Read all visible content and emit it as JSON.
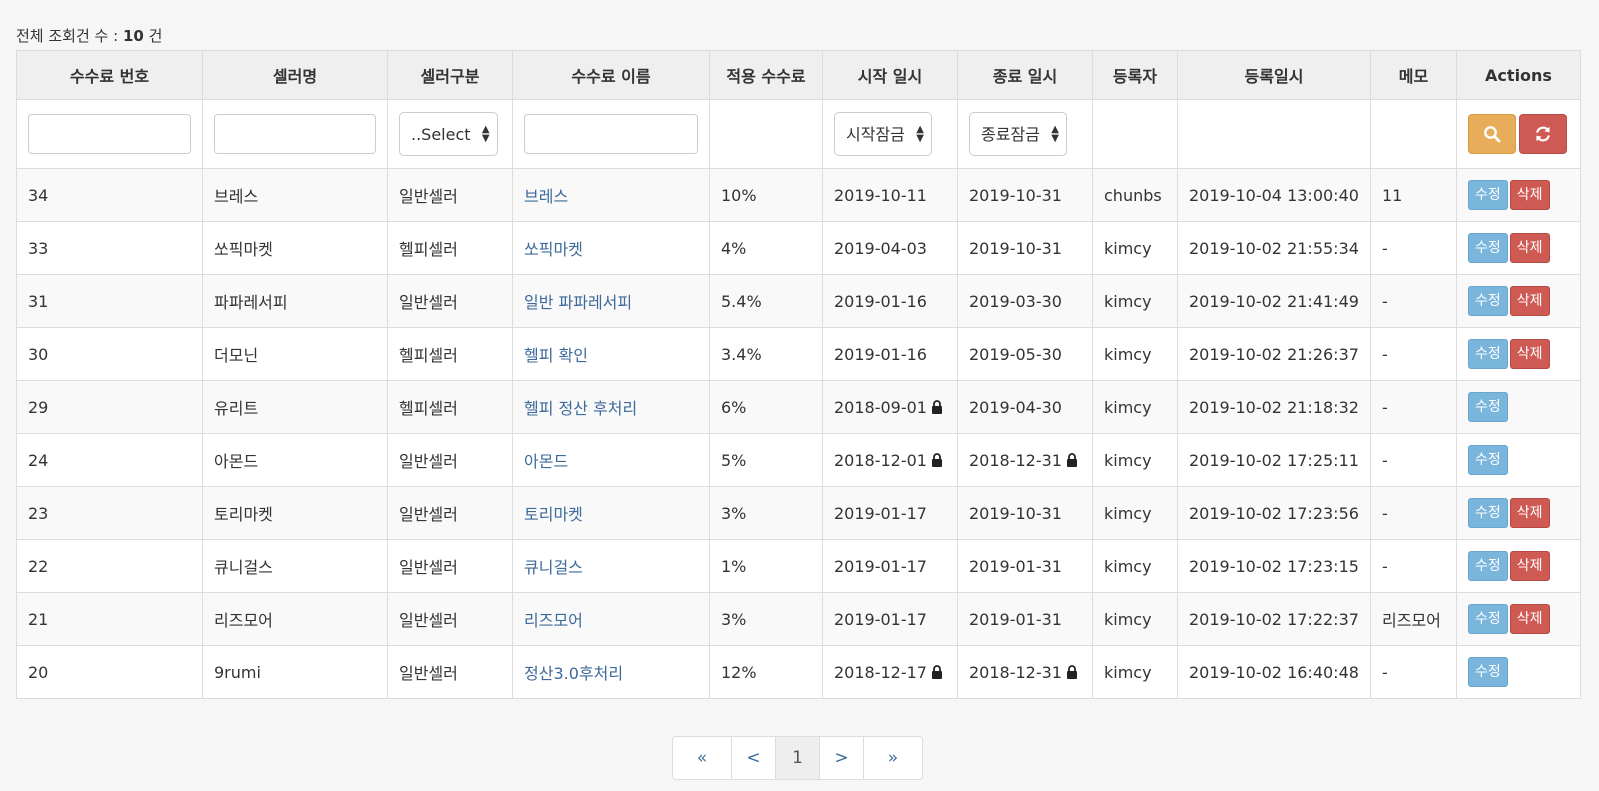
{
  "summary": {
    "prefix": "전체 조회건 수 :",
    "count": "10",
    "suffix": "건"
  },
  "columns": [
    "수수료 번호",
    "셀러명",
    "셀러구분",
    "수수료 이름",
    "적용 수수료",
    "시작 일시",
    "종료 일시",
    "등록자",
    "등록일시",
    "메모",
    "Actions"
  ],
  "filters": {
    "fee_no_value": "",
    "seller_name_value": "",
    "seller_type_selected": "..Select",
    "fee_name_value": "",
    "start_lock_selected": "시작잠금",
    "end_lock_selected": "종료잠금"
  },
  "labels": {
    "edit": "수정",
    "delete": "삭제"
  },
  "rows": [
    {
      "no": "34",
      "seller": "브레스",
      "type": "일반셀러",
      "fee_name": "브레스",
      "rate": "10%",
      "start": "2019-10-11",
      "start_locked": false,
      "end": "2019-10-31",
      "end_locked": false,
      "registrant": "chunbs",
      "reg_time": "2019-10-04 13:00:40",
      "memo": "11",
      "deletable": true
    },
    {
      "no": "33",
      "seller": "쏘픽마켓",
      "type": "헬피셀러",
      "fee_name": "쏘픽마켓",
      "rate": "4%",
      "start": "2019-04-03",
      "start_locked": false,
      "end": "2019-10-31",
      "end_locked": false,
      "registrant": "kimcy",
      "reg_time": "2019-10-02 21:55:34",
      "memo": "-",
      "deletable": true
    },
    {
      "no": "31",
      "seller": "파파레서피",
      "type": "일반셀러",
      "fee_name": "일반 파파레서피",
      "rate": "5.4%",
      "start": "2019-01-16",
      "start_locked": false,
      "end": "2019-03-30",
      "end_locked": false,
      "registrant": "kimcy",
      "reg_time": "2019-10-02 21:41:49",
      "memo": "-",
      "deletable": true
    },
    {
      "no": "30",
      "seller": "더모닌",
      "type": "헬피셀러",
      "fee_name": "헬피 확인",
      "rate": "3.4%",
      "start": "2019-01-16",
      "start_locked": false,
      "end": "2019-05-30",
      "end_locked": false,
      "registrant": "kimcy",
      "reg_time": "2019-10-02 21:26:37",
      "memo": "-",
      "deletable": true
    },
    {
      "no": "29",
      "seller": "유리트",
      "type": "헬피셀러",
      "fee_name": "헬피 정산 후처리",
      "rate": "6%",
      "start": "2018-09-01",
      "start_locked": true,
      "end": "2019-04-30",
      "end_locked": false,
      "registrant": "kimcy",
      "reg_time": "2019-10-02 21:18:32",
      "memo": "-",
      "deletable": false
    },
    {
      "no": "24",
      "seller": "아몬드",
      "type": "일반셀러",
      "fee_name": "아몬드",
      "rate": "5%",
      "start": "2018-12-01",
      "start_locked": true,
      "end": "2018-12-31",
      "end_locked": true,
      "registrant": "kimcy",
      "reg_time": "2019-10-02 17:25:11",
      "memo": "-",
      "deletable": false
    },
    {
      "no": "23",
      "seller": "토리마켓",
      "type": "일반셀러",
      "fee_name": "토리마켓",
      "rate": "3%",
      "start": "2019-01-17",
      "start_locked": false,
      "end": "2019-10-31",
      "end_locked": false,
      "registrant": "kimcy",
      "reg_time": "2019-10-02 17:23:56",
      "memo": "-",
      "deletable": true
    },
    {
      "no": "22",
      "seller": "큐니걸스",
      "type": "일반셀러",
      "fee_name": "큐니걸스",
      "rate": "1%",
      "start": "2019-01-17",
      "start_locked": false,
      "end": "2019-01-31",
      "end_locked": false,
      "registrant": "kimcy",
      "reg_time": "2019-10-02 17:23:15",
      "memo": "-",
      "deletable": true
    },
    {
      "no": "21",
      "seller": "리즈모어",
      "type": "일반셀러",
      "fee_name": "리즈모어",
      "rate": "3%",
      "start": "2019-01-17",
      "start_locked": false,
      "end": "2019-01-31",
      "end_locked": false,
      "registrant": "kimcy",
      "reg_time": "2019-10-02 17:22:37",
      "memo": "리즈모어",
      "deletable": true
    },
    {
      "no": "20",
      "seller": "9rumi",
      "type": "일반셀러",
      "fee_name": "정산3.0후처리",
      "rate": "12%",
      "start": "2018-12-17",
      "start_locked": true,
      "end": "2018-12-31",
      "end_locked": true,
      "registrant": "kimcy",
      "reg_time": "2019-10-02 16:40:48",
      "memo": "-",
      "deletable": false
    }
  ],
  "pagination": {
    "first": "«",
    "prev": "<",
    "current": "1",
    "next": ">",
    "last": "»"
  },
  "colors": {
    "link": "#3d6a9b",
    "edit": "#7ab5dc",
    "delete": "#cf5a54",
    "search": "#e8ad5b",
    "header_bg": "#efefef"
  },
  "icons": {
    "search": "search-icon",
    "reset": "refresh-icon",
    "lock": "lock-icon",
    "select_arrows": "updown-arrows-icon"
  }
}
